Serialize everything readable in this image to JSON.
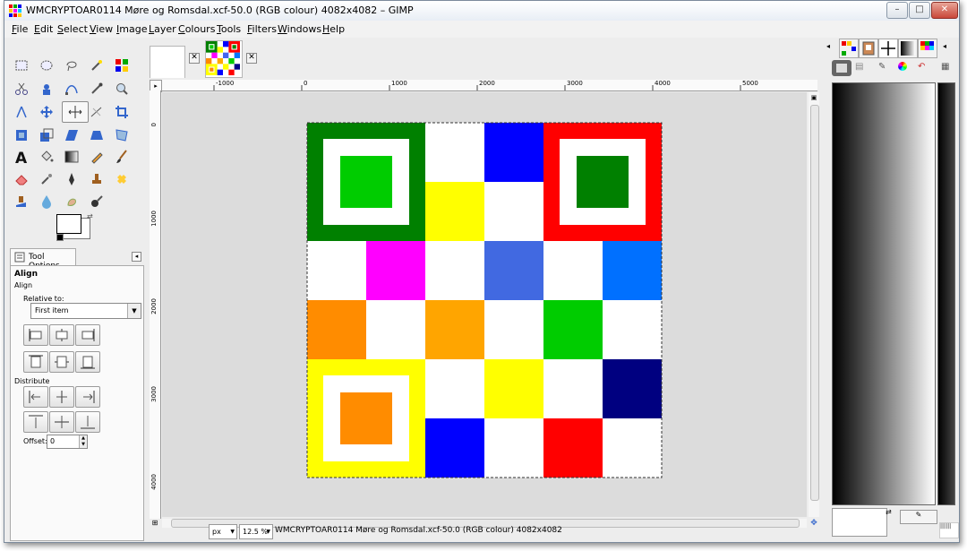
{
  "window": {
    "title": "WMCRYPTOAR0114 Møre og Romsdal.xcf-50.0 (RGB colour) 4082x4082 – GIMP",
    "controls": {
      "minimize": "–",
      "maximize": "□",
      "close": "✕"
    }
  },
  "menu": [
    "File",
    "Edit",
    "Select",
    "View",
    "Image",
    "Layer",
    "Colours",
    "Tools",
    "Filters",
    "Windows",
    "Help"
  ],
  "tool_options": {
    "tab_label": "Tool Options",
    "tool_name": "Align",
    "tool_subtitle": "Align",
    "relative_to_label": "Relative to:",
    "relative_to_value": "First item",
    "distribute_label": "Distribute",
    "offset_label": "Offset:",
    "offset_value": "0"
  },
  "ruler": {
    "h_labels": [
      "-1000",
      "0",
      "1000",
      "2000",
      "3000",
      "4000",
      "5000"
    ],
    "v_labels": [
      "0",
      "1000",
      "2000",
      "3000",
      "4000"
    ]
  },
  "status": {
    "unit": "px",
    "zoom": "12.5 %",
    "message": "WMCRYPTOAR0114 Møre og Romsdal.xcf-50.0 (RGB colour) 4082x4082"
  },
  "image": {
    "grid_rows": 6,
    "grid_cols": 6,
    "cells": [
      [
        "#ffffff",
        "#ffffff",
        "#ffffff",
        "#0000ff",
        "#ffffff",
        "#ffffff"
      ],
      [
        "#ffffff",
        "#ffffff",
        "#ffff00",
        "#ffffff",
        "#ffffff",
        "#ffffff"
      ],
      [
        "#ffffff",
        "#ff00ff",
        "#ffffff",
        "#4169e1",
        "#ffffff",
        "#0070ff"
      ],
      [
        "#ff8c00",
        "#ffffff",
        "#ffa500",
        "#ffffff",
        "#00cc00",
        "#ffffff"
      ],
      [
        "#ffffff",
        "#ffffff",
        "#ffffff",
        "#ffff00",
        "#ffffff",
        "#000080"
      ],
      [
        "#ffffff",
        "#ffffff",
        "#0000ff",
        "#ffffff",
        "#ff0000",
        "#ffffff"
      ]
    ],
    "markers": [
      {
        "outer": "#008000",
        "inner": "#00cc00"
      },
      {
        "outer": "#ff0000",
        "inner": "#008000"
      },
      {
        "outer": "#ffff00",
        "inner": "#ff8c00"
      }
    ]
  },
  "colors": {
    "toolbox_bg": "#ededed",
    "panel_bg": "#fafafa"
  }
}
